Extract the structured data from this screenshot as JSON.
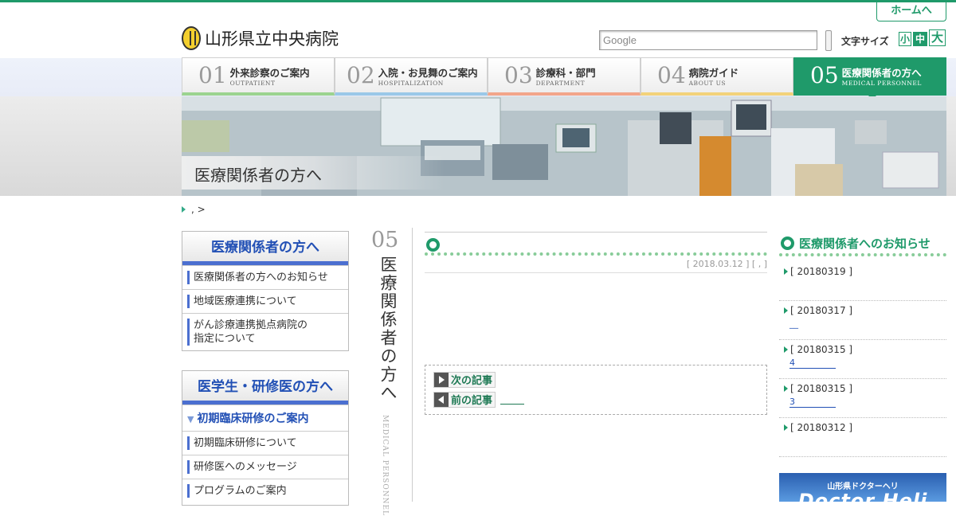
{
  "header": {
    "home_label": "ホームへ",
    "logo_text": "山形県立中央病院",
    "search_placeholder": "Google",
    "font_size_label": "文字サイズ",
    "font_sizes": [
      "小",
      "中",
      "大"
    ]
  },
  "nav": [
    {
      "num": "01",
      "jp": "外来診察のご案内",
      "en": "OUTPATIENT",
      "color": "#9bd38f"
    },
    {
      "num": "02",
      "jp": "入院・お見舞のご案内",
      "en": "HOSPITALIZATION",
      "color": "#9ac8e8"
    },
    {
      "num": "03",
      "jp": "診療科・部門",
      "en": "DEPARTMENT",
      "color": "#f2a58a"
    },
    {
      "num": "04",
      "jp": "病院ガイド",
      "en": "ABOUT US",
      "color": "#f2d27a"
    },
    {
      "num": "05",
      "jp": "医療関係者の方へ",
      "en": "MEDICAL PERSONNEL",
      "color": "#1f9a6a"
    }
  ],
  "hero": {
    "title": "医療関係者の方へ"
  },
  "breadcrumb": {
    "text": ", >"
  },
  "sidebar": {
    "box1": {
      "title": "医療関係者の方へ",
      "links": [
        "医療関係者の方へのお知らせ",
        "地域医療連携について",
        "がん診療連携拠点病院の指定について"
      ]
    },
    "box2": {
      "title": "医学生・研修医の方へ",
      "sub_title": "初期臨床研修のご案内",
      "links": [
        "初期臨床研修について",
        "研修医へのメッセージ",
        "プログラムのご案内"
      ]
    }
  },
  "vertical": {
    "num": "05",
    "jp": "医療関係者の方へ",
    "en": "MEDICAL PERSONNEL"
  },
  "content": {
    "date": "[ 2018.03.12 ] [ , ]",
    "next_label": "次の記事",
    "prev_label": "前の記事"
  },
  "news": {
    "title": "医療関係者へのお知らせ",
    "items": [
      {
        "date": "[ 20180319 ]",
        "link": ""
      },
      {
        "date": "[ 20180317 ]",
        "link": "__"
      },
      {
        "date": "[ 20180315 ]",
        "link": "4"
      },
      {
        "date": "[ 20180315 ]",
        "link": "3"
      },
      {
        "date": "[ 20180312 ]",
        "link": ""
      }
    ]
  },
  "banner": {
    "top": "山形県ドクターヘリ",
    "big": "Doctor Heli"
  }
}
